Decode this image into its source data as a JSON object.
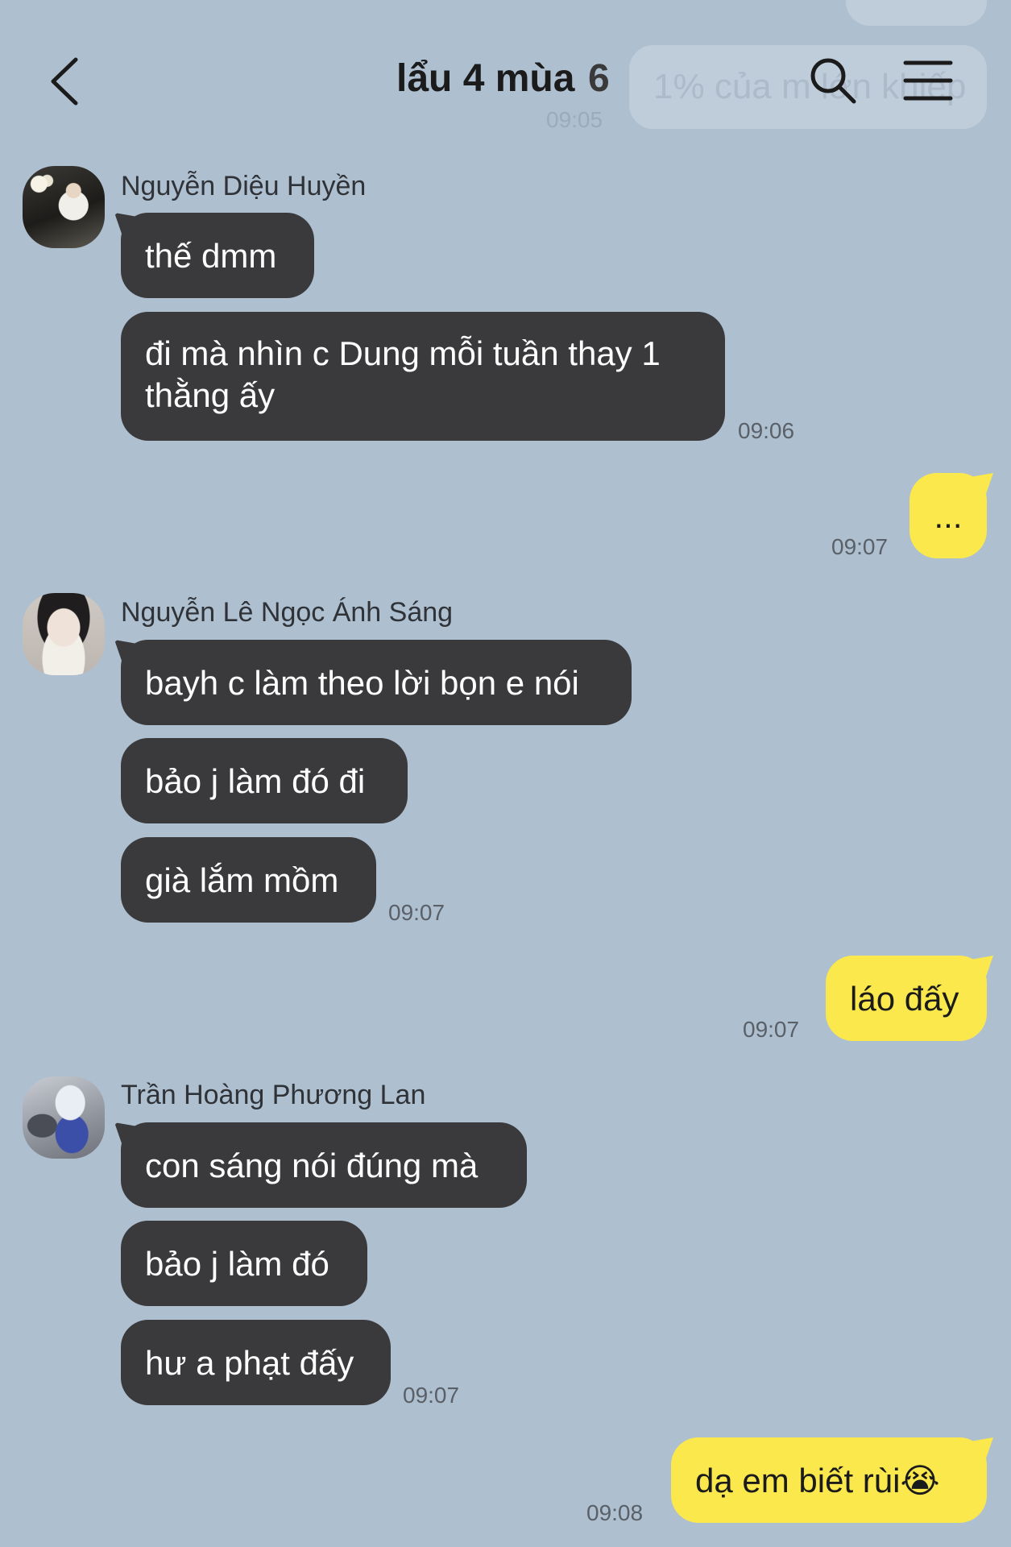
{
  "header": {
    "title": "lẩu 4 mùa",
    "member_count": "6",
    "ghost_message": "1% của m lớn khiếp",
    "ghost_time": "09:05"
  },
  "messages": [
    {
      "sender": "Nguyễn Diệu Huyền",
      "bubbles": [
        "thế dmm",
        "đi mà nhìn c Dung mỗi tuần thay 1 thằng ấy"
      ],
      "time": "09:06"
    },
    {
      "sender": "me",
      "bubbles": [
        "..."
      ],
      "time": "09:07"
    },
    {
      "sender": "Nguyễn Lê Ngọc Ánh Sáng",
      "bubbles": [
        "bayh c làm theo lời bọn e nói",
        "bảo j làm đó đi",
        "già lắm mồm"
      ],
      "time": "09:07"
    },
    {
      "sender": "me",
      "bubbles": [
        "láo đấy"
      ],
      "time": "09:07"
    },
    {
      "sender": "Trần Hoàng Phương Lan",
      "bubbles": [
        "con sáng nói đúng mà",
        "bảo j làm đó",
        "hư a phạt đấy"
      ],
      "time": "09:07"
    },
    {
      "sender": "me",
      "bubbles": [
        "dạ em biết rùi😭"
      ],
      "time": "09:08"
    }
  ],
  "icons": {
    "back": "chevron-left-icon",
    "search": "search-icon",
    "menu": "hamburger-menu-icon"
  },
  "colors": {
    "background": "#aebfd0",
    "incoming_bubble": "#3a3a3c",
    "outgoing_bubble": "#fae84c"
  }
}
